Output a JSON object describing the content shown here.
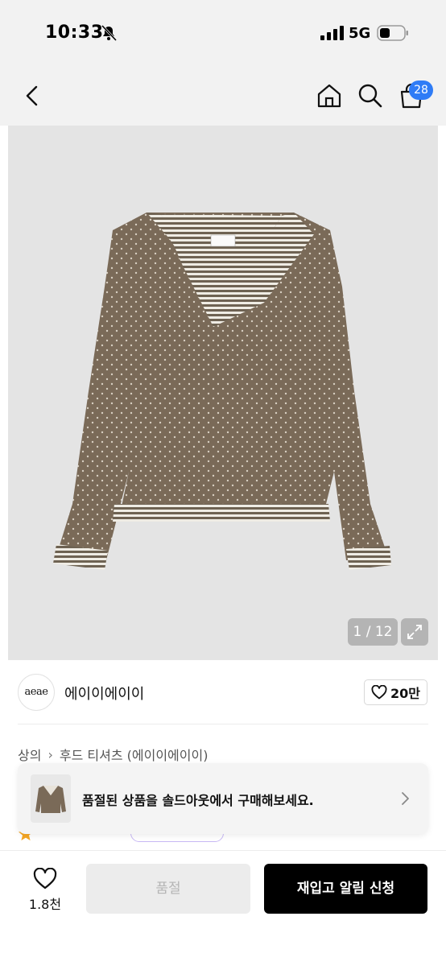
{
  "status_bar": {
    "time": "10:33",
    "network": "5G"
  },
  "nav": {
    "cart_count": "28"
  },
  "gallery": {
    "counter": "1 / 12"
  },
  "brand": {
    "logo_text": "aeae",
    "name": "에이이에이이",
    "like_count": "20만"
  },
  "breadcrumb": {
    "category": "상의",
    "subcategory": "후드 티셔츠 (에이이에이이)"
  },
  "soldout_banner": {
    "text": "품절된 상품을 솔드아웃에서 구매해보세요."
  },
  "bottom_bar": {
    "wish_count": "1.8천",
    "soldout_label": "품절",
    "restock_label": "재입고 알림 신청"
  },
  "colors": {
    "badge": "#2f7cf6",
    "product": "#7a6a58",
    "primary_button": "#000000"
  }
}
